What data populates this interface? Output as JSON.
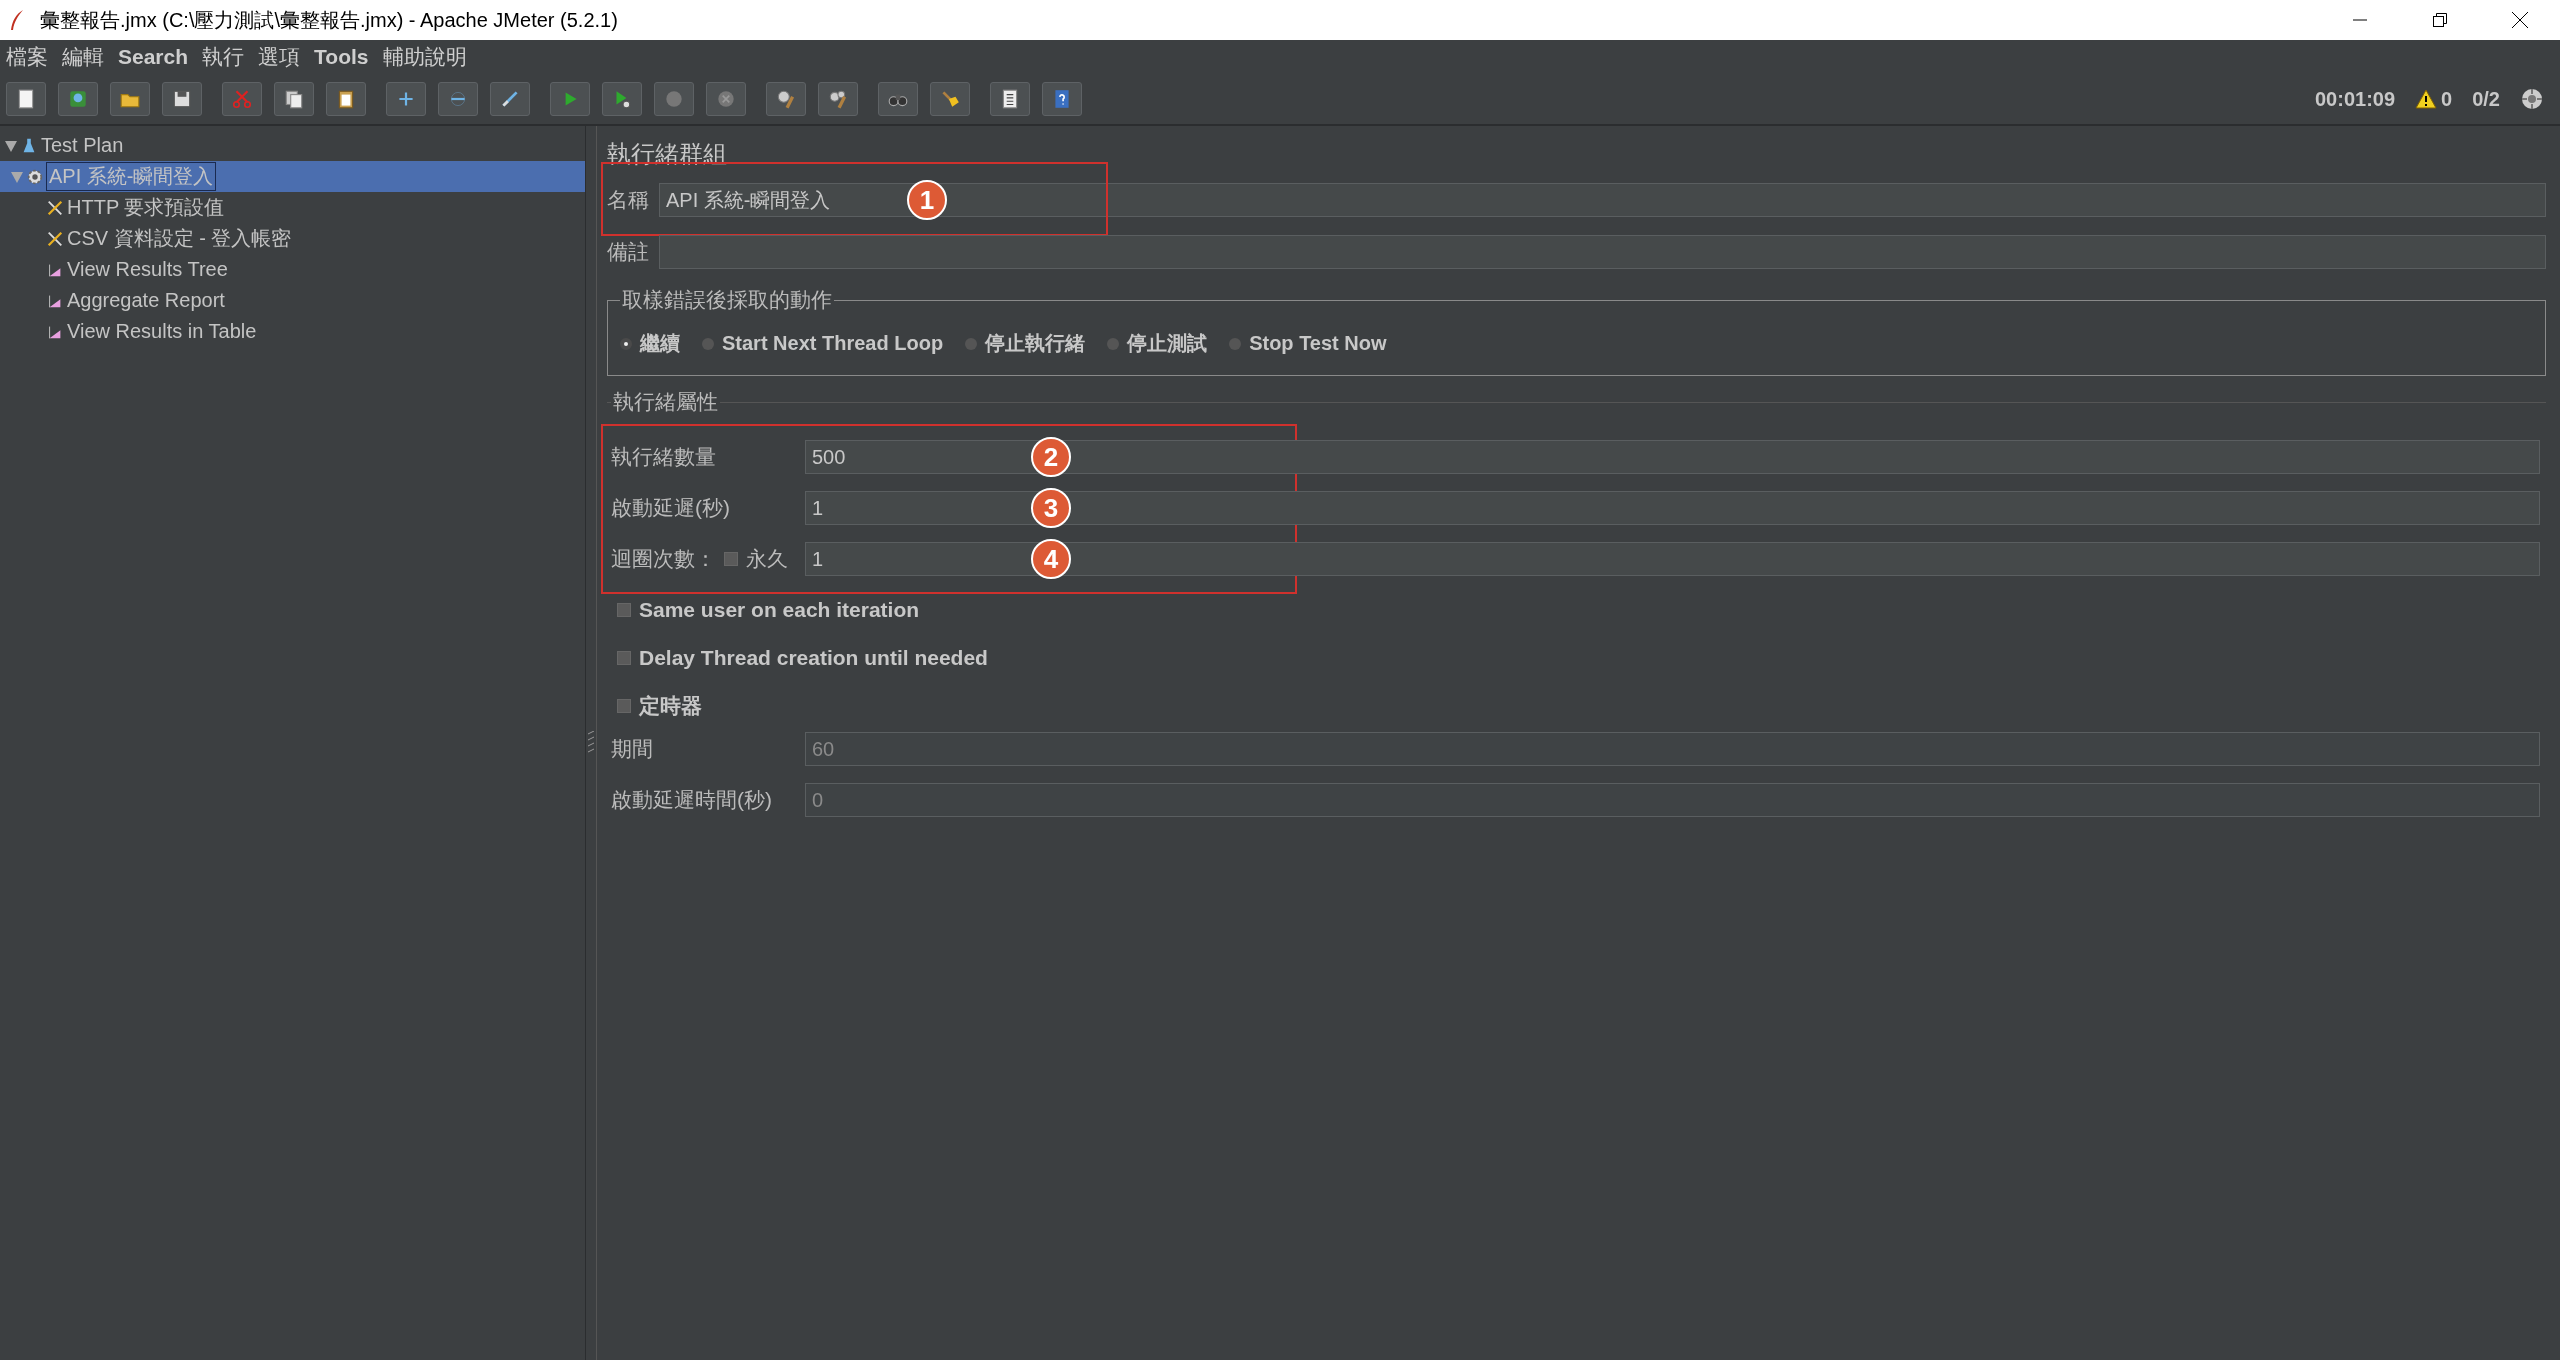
{
  "window": {
    "title": "彙整報告.jmx (C:\\壓力測試\\彙整報告.jmx) - Apache JMeter (5.2.1)"
  },
  "menu": [
    {
      "label": "檔案",
      "bold": false
    },
    {
      "label": "編輯",
      "bold": false
    },
    {
      "label": "Search",
      "bold": true
    },
    {
      "label": "執行",
      "bold": false
    },
    {
      "label": "選項",
      "bold": false
    },
    {
      "label": "Tools",
      "bold": true
    },
    {
      "label": "輔助說明",
      "bold": false
    }
  ],
  "status": {
    "elapsed": "00:01:09",
    "warnings": "0",
    "threads": "0/2"
  },
  "tree": [
    {
      "label": "Test Plan",
      "kind": "plan",
      "selected": false,
      "expanded": true,
      "children": [
        {
          "label": "API 系統-瞬間登入",
          "kind": "thread-group",
          "selected": true,
          "expanded": true,
          "children": [
            {
              "label": "HTTP 要求預設值",
              "kind": "config",
              "selected": false
            },
            {
              "label": "CSV 資料設定 - 登入帳密",
              "kind": "config",
              "selected": false
            },
            {
              "label": "View Results Tree",
              "kind": "listener",
              "selected": false
            },
            {
              "label": "Aggregate Report",
              "kind": "listener",
              "selected": false
            },
            {
              "label": "View Results in Table",
              "kind": "listener",
              "selected": false
            }
          ]
        }
      ]
    }
  ],
  "panel": {
    "title": "執行緒群組",
    "name": {
      "label": "名稱",
      "value": "API 系統-瞬間登入",
      "marker": "1"
    },
    "comments": {
      "label": "備註"
    },
    "on_error": {
      "legend": "取樣錯誤後採取的動作",
      "options": [
        {
          "label": "繼續",
          "selected": true
        },
        {
          "label": "Start Next Thread Loop",
          "selected": false
        },
        {
          "label": "停止執行緒",
          "selected": false
        },
        {
          "label": "停止測試",
          "selected": false
        },
        {
          "label": "Stop Test Now",
          "selected": false
        }
      ]
    },
    "thread_properties": {
      "legend": "執行緒屬性",
      "threads": {
        "label": "執行緒數量",
        "value": "500",
        "marker": "2"
      },
      "ramp_up": {
        "label": "啟動延遲(秒)",
        "value": "1",
        "marker": "3"
      },
      "loop": {
        "label": "迴圈次數：",
        "forever": {
          "label": "永久",
          "checked": false
        },
        "value": "1",
        "marker": "4"
      },
      "checkboxes": [
        {
          "label": "Same user on each iteration",
          "checked": false
        },
        {
          "label": "Delay Thread creation until needed",
          "checked": false
        },
        {
          "label": "定時器",
          "checked": false
        }
      ],
      "duration": {
        "label": "期間",
        "value": "60",
        "disabled": true
      },
      "startup_delay": {
        "label": "啟動延遲時間(秒)",
        "value": "0",
        "disabled": true
      }
    }
  }
}
